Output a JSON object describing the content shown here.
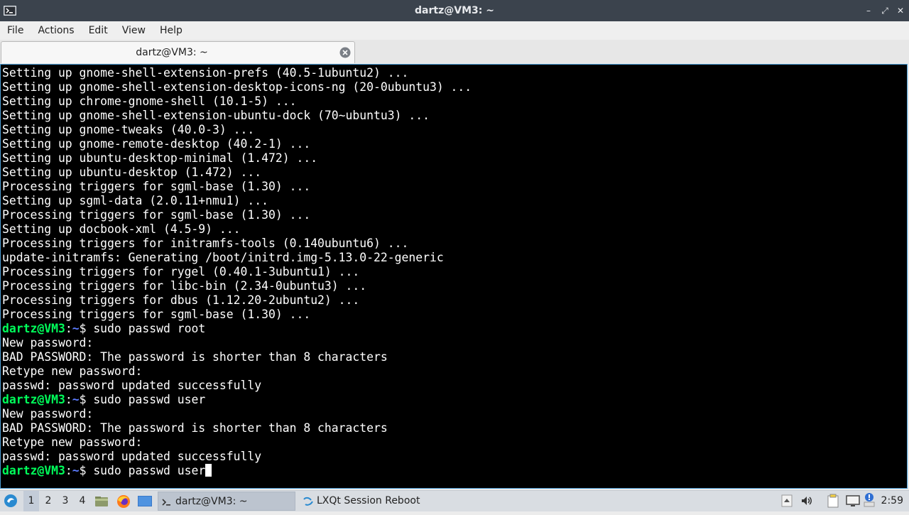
{
  "window": {
    "title": "dartz@VM3: ~",
    "controls": {
      "minimize": "–",
      "maximize": "⤢",
      "close": "✕"
    }
  },
  "menubar": {
    "items": [
      "File",
      "Actions",
      "Edit",
      "View",
      "Help"
    ]
  },
  "tab": {
    "label": "dartz@VM3: ~"
  },
  "terminal": {
    "lines": [
      {
        "text": "Setting up gnome-shell-extension-prefs (40.5-1ubuntu2) ..."
      },
      {
        "text": "Setting up gnome-shell-extension-desktop-icons-ng (20-0ubuntu3) ..."
      },
      {
        "text": "Setting up chrome-gnome-shell (10.1-5) ..."
      },
      {
        "text": "Setting up gnome-shell-extension-ubuntu-dock (70~ubuntu3) ..."
      },
      {
        "text": "Setting up gnome-tweaks (40.0-3) ..."
      },
      {
        "text": "Setting up gnome-remote-desktop (40.2-1) ..."
      },
      {
        "text": "Setting up ubuntu-desktop-minimal (1.472) ..."
      },
      {
        "text": "Setting up ubuntu-desktop (1.472) ..."
      },
      {
        "text": "Processing triggers for sgml-base (1.30) ..."
      },
      {
        "text": "Setting up sgml-data (2.0.11+nmu1) ..."
      },
      {
        "text": "Processing triggers for sgml-base (1.30) ..."
      },
      {
        "text": "Setting up docbook-xml (4.5-9) ..."
      },
      {
        "text": "Processing triggers for initramfs-tools (0.140ubuntu6) ..."
      },
      {
        "text": "update-initramfs: Generating /boot/initrd.img-5.13.0-22-generic"
      },
      {
        "text": "Processing triggers for rygel (0.40.1-3ubuntu1) ..."
      },
      {
        "text": "Processing triggers for libc-bin (2.34-0ubuntu3) ..."
      },
      {
        "text": "Processing triggers for dbus (1.12.20-2ubuntu2) ..."
      },
      {
        "text": "Processing triggers for sgml-base (1.30) ..."
      },
      {
        "prompt": "dartz@VM3",
        "path": "~",
        "command": "sudo passwd root"
      },
      {
        "text": "New password: "
      },
      {
        "text": "BAD PASSWORD: The password is shorter than 8 characters"
      },
      {
        "text": "Retype new password: "
      },
      {
        "text": "passwd: password updated successfully"
      },
      {
        "prompt": "dartz@VM3",
        "path": "~",
        "command": "sudo passwd user"
      },
      {
        "text": "New password: "
      },
      {
        "text": "BAD PASSWORD: The password is shorter than 8 characters"
      },
      {
        "text": "Retype new password: "
      },
      {
        "text": "passwd: password updated successfully"
      },
      {
        "prompt": "dartz@VM3",
        "path": "~",
        "command": "sudo passwd user",
        "cursor": true
      }
    ]
  },
  "taskbar": {
    "desktops": [
      "1",
      "2",
      "3",
      "4"
    ],
    "active_desktop": "1",
    "tasks": [
      {
        "label": "dartz@VM3: ~",
        "icon": "terminal-icon",
        "active": true
      },
      {
        "label": "LXQt Session Reboot",
        "icon": "lxqt-icon",
        "active": false
      }
    ],
    "clock": "2:59"
  },
  "colors": {
    "titlebar": "#3b434d",
    "terminal_bg": "#000000",
    "prompt_user": "#00ff5b",
    "prompt_path": "#5c7cff",
    "terminal_border": "#4b9cd4"
  }
}
